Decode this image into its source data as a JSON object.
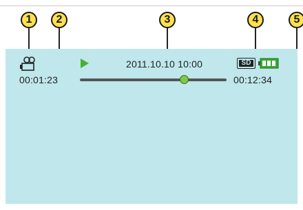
{
  "callouts": [
    "1",
    "2",
    "3",
    "4",
    "5"
  ],
  "osd": {
    "mode_icon": "video-camera-icon",
    "play_icon": "play-icon",
    "datetime": "2011.10.10 10:00",
    "media_badge": "SD",
    "battery_icon": "battery-full-icon",
    "elapsed_time": "00:01:23",
    "total_time": "00:12:34",
    "progress_fraction": 0.71
  },
  "colors": {
    "screen_background": "#bfe7ec",
    "callout_fill": "#ffe14f",
    "play_green": "#46b035",
    "battery_green": "#3aa833",
    "slider_thumb": "#7ec845"
  }
}
